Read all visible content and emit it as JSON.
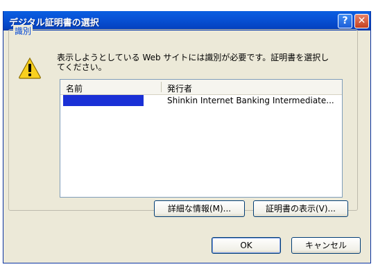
{
  "window": {
    "title": "デジタル証明書の選択",
    "help_glyph": "?",
    "close_glyph": "✕"
  },
  "group": {
    "label": "識別"
  },
  "message": {
    "text": "表示しようとしている Web サイトには識別が必要です。証明書を選択してください。"
  },
  "certificate_list": {
    "columns": [
      "名前",
      "発行者"
    ],
    "rows": [
      {
        "name": "",
        "issuer": "Shinkin Internet Banking Intermediate..."
      }
    ]
  },
  "buttons": {
    "details": "詳細な情報(M)...",
    "view_cert": "証明書の表示(V)...",
    "ok": "OK",
    "cancel": "キャンセル"
  },
  "icons": {
    "warning": "warning-icon"
  }
}
